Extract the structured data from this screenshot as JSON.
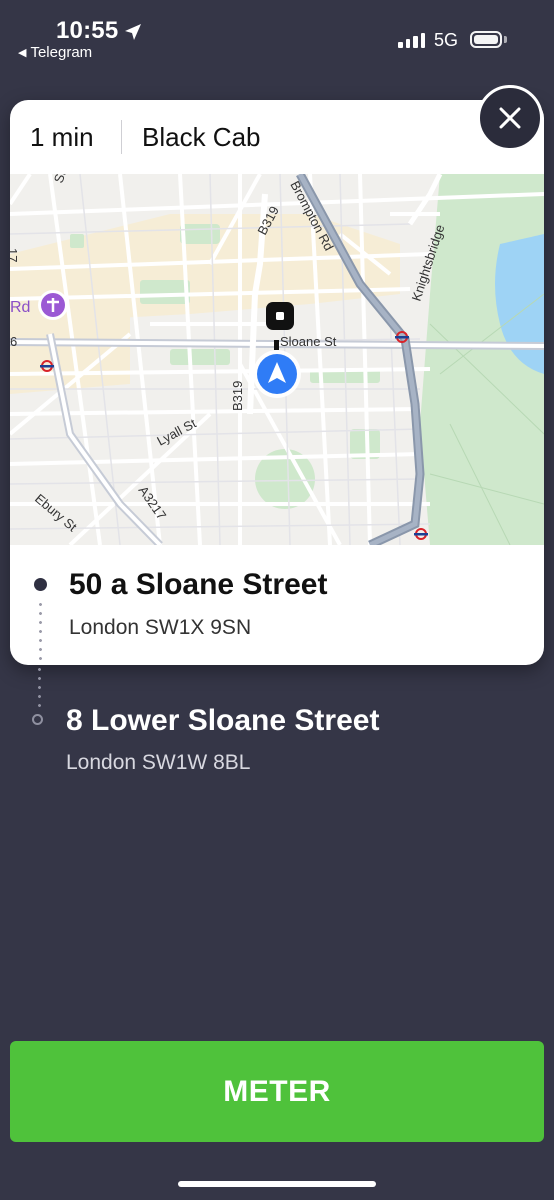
{
  "status_bar": {
    "time": "10:55",
    "back_app": "Telegram",
    "network": "5G",
    "location_icon": "location-arrow-icon",
    "signal_icon": "signal-bars-icon",
    "battery_icon": "battery-icon"
  },
  "trip": {
    "eta": "1 min",
    "vehicle": "Black Cab"
  },
  "map": {
    "labels": {
      "sloane_st": "Sloane St",
      "brompton_rd": "Brompton Rd",
      "knightsbridge": "Knightsbridge",
      "b319_top": "B319",
      "b319_mid": "B319",
      "lyall_st": "Lyall St",
      "a3217": "A3217",
      "ebury_st": "Ebury St",
      "rd": "Rd",
      "partial_17": "17",
      "partial_6": "6",
      "partial_st": "St"
    },
    "icons": [
      "hospital-icon",
      "underground-icon",
      "pickup-marker-icon",
      "navigation-arrow-icon"
    ],
    "colors": {
      "park": "#cfe8cc",
      "water": "#9ed3f5",
      "major_road": "#8a97ab",
      "highlight_area": "#f6edd6",
      "nav_blue": "#2f7cf6"
    }
  },
  "pickup": {
    "title": "50 a Sloane Street",
    "subtitle": "London SW1X 9SN"
  },
  "destination": {
    "title": "8 Lower Sloane Street",
    "subtitle": "London SW1W 8BL"
  },
  "actions": {
    "meter_label": "METER",
    "close_icon": "close-icon"
  },
  "colors": {
    "background": "#353647",
    "meter_button": "#4fc23b",
    "card": "#ffffff"
  }
}
